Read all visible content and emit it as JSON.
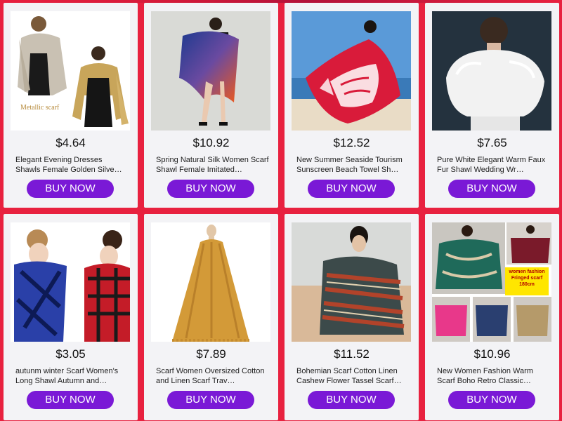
{
  "products": [
    {
      "price": "$4.64",
      "title": "Elegant Evening Dresses Shawls Female Golden Silve…",
      "button": "BUY NOW",
      "image_caption": "Metallic scarf",
      "image": "metallic-scarf"
    },
    {
      "price": "$10.92",
      "title": "Spring Natural Silk Women Scarf Shawl Female Imitated…",
      "button": "BUY NOW",
      "image": "gradient-silk-scarf"
    },
    {
      "price": "$12.52",
      "title": "New Summer Seaside Tourism Sunscreen Beach Towel Sh…",
      "button": "BUY NOW",
      "image": "beach-shawl"
    },
    {
      "price": "$7.65",
      "title": "Pure White Elegant Warm Faux Fur Shawl Wedding Wr…",
      "button": "BUY NOW",
      "image": "faux-fur-shawl"
    },
    {
      "price": "$3.05",
      "title": "autunm winter Scarf Women's Long Shawl Autumn and…",
      "button": "BUY NOW",
      "image": "plaid-scarves"
    },
    {
      "price": "$7.89",
      "title": "Scarf Women Oversized Cotton and Linen Scarf Trav…",
      "button": "BUY NOW",
      "image": "mustard-scarf"
    },
    {
      "price": "$11.52",
      "title": "Bohemian Scarf Cotton Linen Cashew Flower Tassel Scarf…",
      "button": "BUY NOW",
      "image": "bohemian-scarf"
    },
    {
      "price": "$10.96",
      "title": "New Women Fashion Warm Scarf Boho Retro Classic…",
      "button": "BUY NOW",
      "image": "boho-fringed-scarf",
      "image_badge": [
        "women fashion",
        "Fringed scarf",
        "180cm"
      ]
    }
  ]
}
